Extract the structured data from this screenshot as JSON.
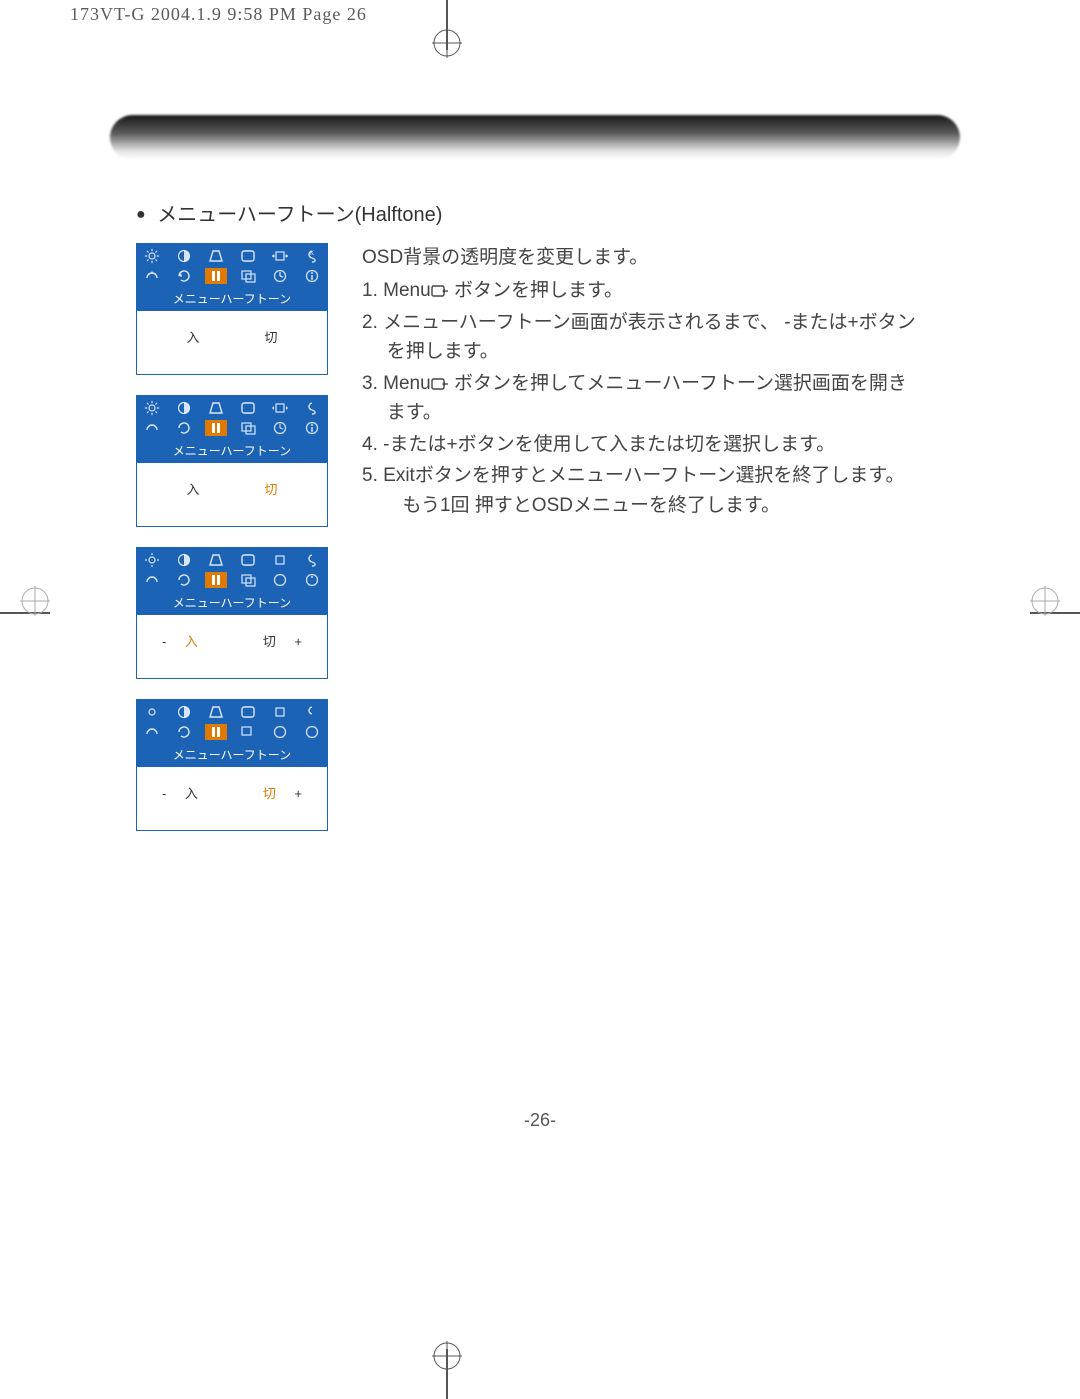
{
  "file_header": "173VT-G  2004.1.9 9:58 PM  Page 26",
  "section": {
    "title_prefix": "●",
    "title": "メニューハーフトーン(Halftone)"
  },
  "osd_label": "メニューハーフトーン",
  "osd_panels": [
    {
      "on_text": "入",
      "off_text": "切",
      "on_prefix": "",
      "on_suffix": "",
      "off_prefix": "",
      "off_suffix": "",
      "on_highlight": false,
      "off_highlight": false,
      "icon_row2_selected_index": 2
    },
    {
      "on_text": "入",
      "off_text": "切",
      "on_prefix": "",
      "on_suffix": "",
      "off_prefix": "",
      "off_suffix": "",
      "on_highlight": false,
      "off_highlight": true,
      "icon_row2_selected_index": 2
    },
    {
      "on_text": "入",
      "off_text": "切",
      "on_prefix": "-",
      "on_suffix": "",
      "off_prefix": "",
      "off_suffix": "+",
      "on_highlight": true,
      "off_highlight": false,
      "icon_row2_selected_index": 2
    },
    {
      "on_text": "入",
      "off_text": "切",
      "on_prefix": "-",
      "on_suffix": "",
      "off_prefix": "",
      "off_suffix": "+",
      "on_highlight": false,
      "off_highlight": true,
      "icon_row2_selected_index": 2
    }
  ],
  "instructions": {
    "intro": "OSD背景の透明度を変更します。",
    "steps_num": [
      "1.",
      "2.",
      "3.",
      "4.",
      "5."
    ],
    "steps_a": "Menu",
    "step1_b": " ボタンを押します。",
    "step2": "メニューハーフトーン画面が表示されるまで、 -または+ボタンを押します。",
    "step3_a": "Menu",
    "step3_b": " ボタンを押してメニューハーフトーン選択画面を開きます。",
    "step4": "-または+ボタンを使用して入または切を選択します。",
    "step5_a": "Exitボタンを押すとメニューハーフトーン選択を終了します。",
    "step5_b": "もう1回 押すとOSDメニューを終了します。"
  },
  "page_number": "-26-"
}
